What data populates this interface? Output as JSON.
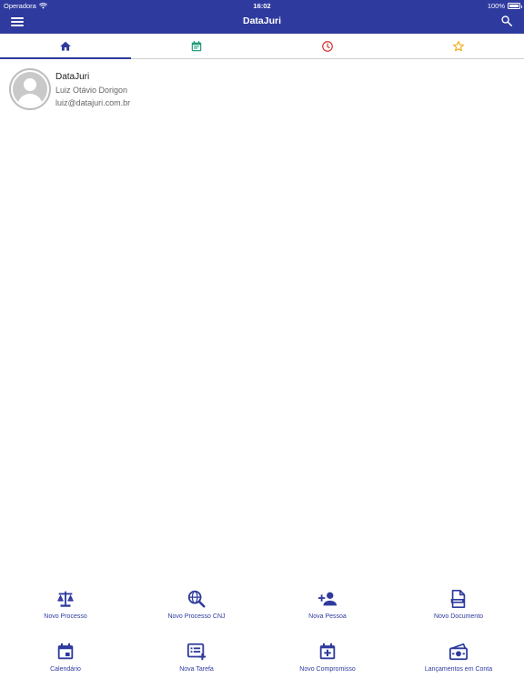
{
  "status_bar": {
    "carrier": "Operadora",
    "time": "16:02",
    "battery": "100%"
  },
  "app": {
    "title": "DataJuri"
  },
  "tabs": [
    {
      "icon": "home-icon",
      "color": "#2e3a9e",
      "selected": true
    },
    {
      "icon": "calendar-event-icon",
      "color": "#1a9a78",
      "selected": false
    },
    {
      "icon": "clock-icon",
      "color": "#d32f2f",
      "selected": false
    },
    {
      "icon": "star-icon",
      "color": "#f0a500",
      "selected": false
    }
  ],
  "profile": {
    "app_name": "DataJuri",
    "user_name": "Luiz Otávio Dorigon",
    "email": "luiz@datajuri.com.br"
  },
  "quick_actions": [
    {
      "label": "Novo Processo",
      "icon": "scales-icon"
    },
    {
      "label": "Novo Processo CNJ",
      "icon": "globe-search-icon"
    },
    {
      "label": "Nova Pessoa",
      "icon": "add-person-icon"
    },
    {
      "label": "Novo Documento",
      "icon": "document-icon"
    },
    {
      "label": "Calendário",
      "icon": "calendar-icon"
    },
    {
      "label": "Nova Tarefa",
      "icon": "add-task-icon"
    },
    {
      "label": "Novo Compromisso",
      "icon": "calendar-add-icon"
    },
    {
      "label": "Lançamentos em Conta",
      "icon": "money-icon"
    }
  ],
  "colors": {
    "primary": "#2e3a9e",
    "background": "#ffffff"
  }
}
